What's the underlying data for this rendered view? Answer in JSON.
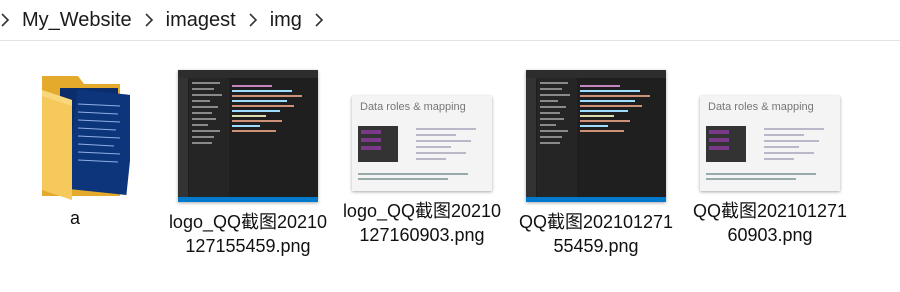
{
  "breadcrumb": {
    "items": [
      "My_Website",
      "imagest",
      "img"
    ]
  },
  "files": [
    {
      "name": "a",
      "kind": "folder"
    },
    {
      "name": "logo_QQ截图20210127155459.png",
      "kind": "dark-code"
    },
    {
      "name": "logo_QQ截图20210127160903.png",
      "kind": "slide",
      "slide_title": "Data roles & mapping"
    },
    {
      "name": "QQ截图20210127155459.png",
      "kind": "dark-code"
    },
    {
      "name": "QQ截图20210127160903.png",
      "kind": "slide",
      "slide_title": "Data roles & mapping"
    }
  ],
  "colors": {
    "folder": "#f5c95c",
    "folder_dark": "#e3aa2c",
    "doc_blue": "#0b2d6b",
    "accent": "#007acc"
  }
}
